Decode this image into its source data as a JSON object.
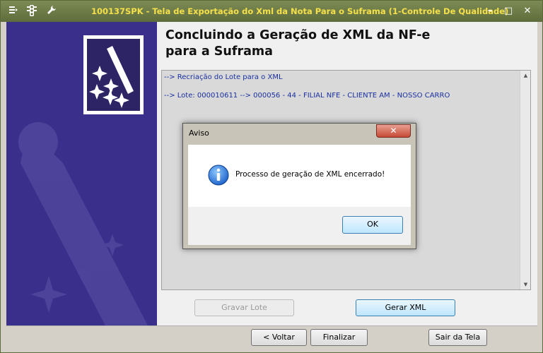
{
  "window": {
    "title": "100137SPK - Tela de Exportação do Xml da Nota Para o Suframa (1-Controle De Qualidade)",
    "minimize": "–",
    "maximize": "□",
    "close": "✕"
  },
  "titlebar_icons": [
    "menu-icon",
    "traffic-light-icon",
    "wrench-icon"
  ],
  "heading": {
    "line1": "Concluindo a Geração de XML da NF-e",
    "line2": "para a Suframa"
  },
  "log": {
    "lines": [
      "--> Recriação do Lote para o XML",
      "--> Lote: 000010611 --> 000056 - 44 - FILIAL NFE - CLIENTE AM - NOSSO CARRO"
    ]
  },
  "buttons": {
    "gravar_lote": "Gravar Lote",
    "gerar_xml": "Gerar XML",
    "voltar": "< Voltar",
    "finalizar": "Finalizar",
    "sair": "Sair da Tela"
  },
  "dialog": {
    "title": "Aviso",
    "close": "✕",
    "message": "Processo de geração de XML encerrado!",
    "ok": "OK"
  },
  "colors": {
    "titlebar": "#6b7946",
    "title_text": "#f5e04a",
    "side_panel": "#3a2f8a",
    "log_text": "#1a2fa0"
  }
}
